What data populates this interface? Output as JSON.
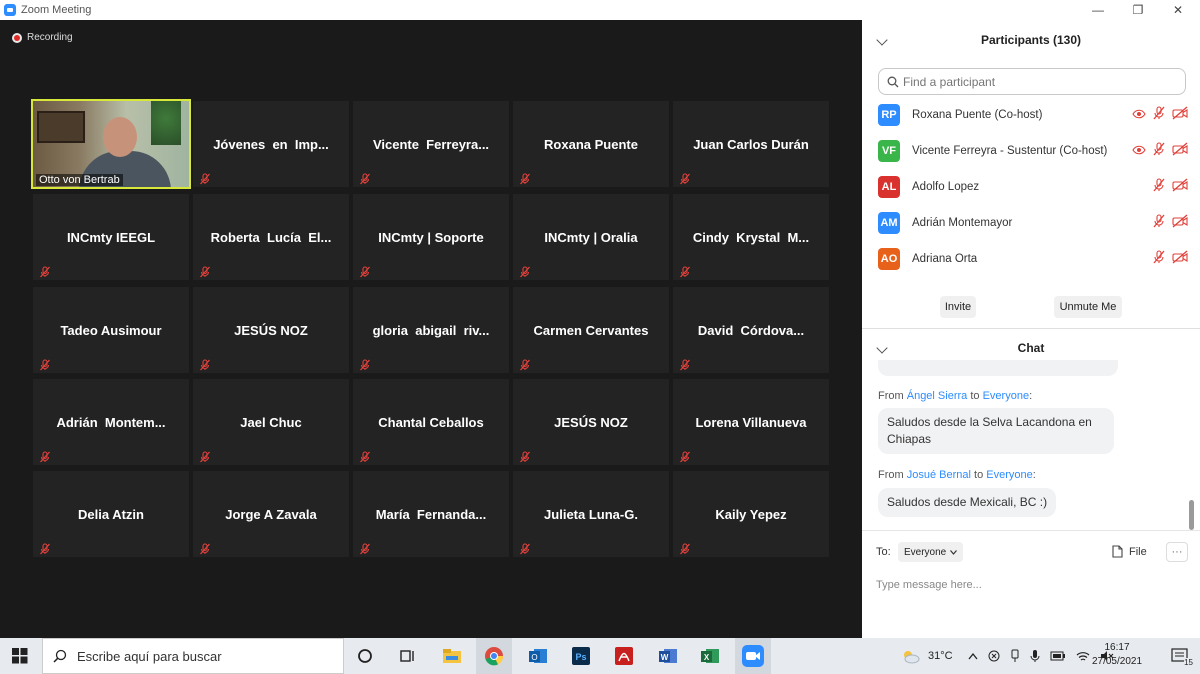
{
  "window": {
    "title": "Zoom Meeting",
    "minimize": "—",
    "maximize": "❐",
    "close": "✕"
  },
  "recording": {
    "label": "Recording"
  },
  "active_speaker": {
    "name": "Otto von Bertrab"
  },
  "tiles": [
    "Jóvenes  en  Imp...",
    "Vicente  Ferreyra...",
    "Roxana Puente",
    "Juan Carlos Durán",
    "INCmty IEEGL",
    "Roberta  Lucía  El...",
    "INCmty | Soporte",
    "INCmty | Oralia",
    "Cindy  Krystal  M...",
    "Tadeo Ausimour",
    "JESÚS NOZ",
    "gloria  abigail  riv...",
    "Carmen Cervantes",
    "David  Córdova...",
    "Adrián  Montem...",
    "Jael Chuc",
    "Chantal Ceballos",
    "JESÚS NOZ",
    "Lorena Villanueva",
    "Delia Atzin",
    "Jorge A Zavala",
    "María  Fernanda...",
    "Julieta Luna-G.",
    "Kaily Yepez"
  ],
  "participants": {
    "title": "Participants (130)",
    "search_placeholder": "Find a participant",
    "list": [
      {
        "initials": "RP",
        "name": "Roxana Puente (Co-host)",
        "color": "#2d8cff",
        "video_icon": true
      },
      {
        "initials": "VF",
        "name": "Vicente Ferreyra - Sustentur (Co-host)",
        "color": "#3ab54a",
        "video_icon": true
      },
      {
        "initials": "AL",
        "name": "Adolfo Lopez",
        "color": "#d9322e",
        "video_icon": false
      },
      {
        "initials": "AM",
        "name": "Adrián Montemayor",
        "color": "#2d8cff",
        "video_icon": false
      },
      {
        "initials": "AO",
        "name": "Adriana Orta",
        "color": "#e8611a",
        "video_icon": false
      }
    ],
    "invite_label": "Invite",
    "unmute_label": "Unmute Me"
  },
  "chat": {
    "title": "Chat",
    "messages": [
      {
        "from": "Ángel Sierra",
        "to": "Everyone",
        "text_line1": "Saludos desde la Selva Lacandona en",
        "text_line2": "Chiapas"
      },
      {
        "from": "Josué Bernal",
        "to": "Everyone",
        "text_line1": "Saludos desde Mexicali, BC :)"
      }
    ],
    "from_prefix": "From",
    "to_word": "to",
    "to_label": "To:",
    "to_target": "Everyone",
    "file_label": "File",
    "more_label": "···",
    "input_placeholder": "Type message here..."
  },
  "taskbar": {
    "search_placeholder": "Escribe aquí para buscar",
    "temperature": "31°C",
    "time": "16:17",
    "date": "27/05/2021",
    "notifications": "15"
  }
}
